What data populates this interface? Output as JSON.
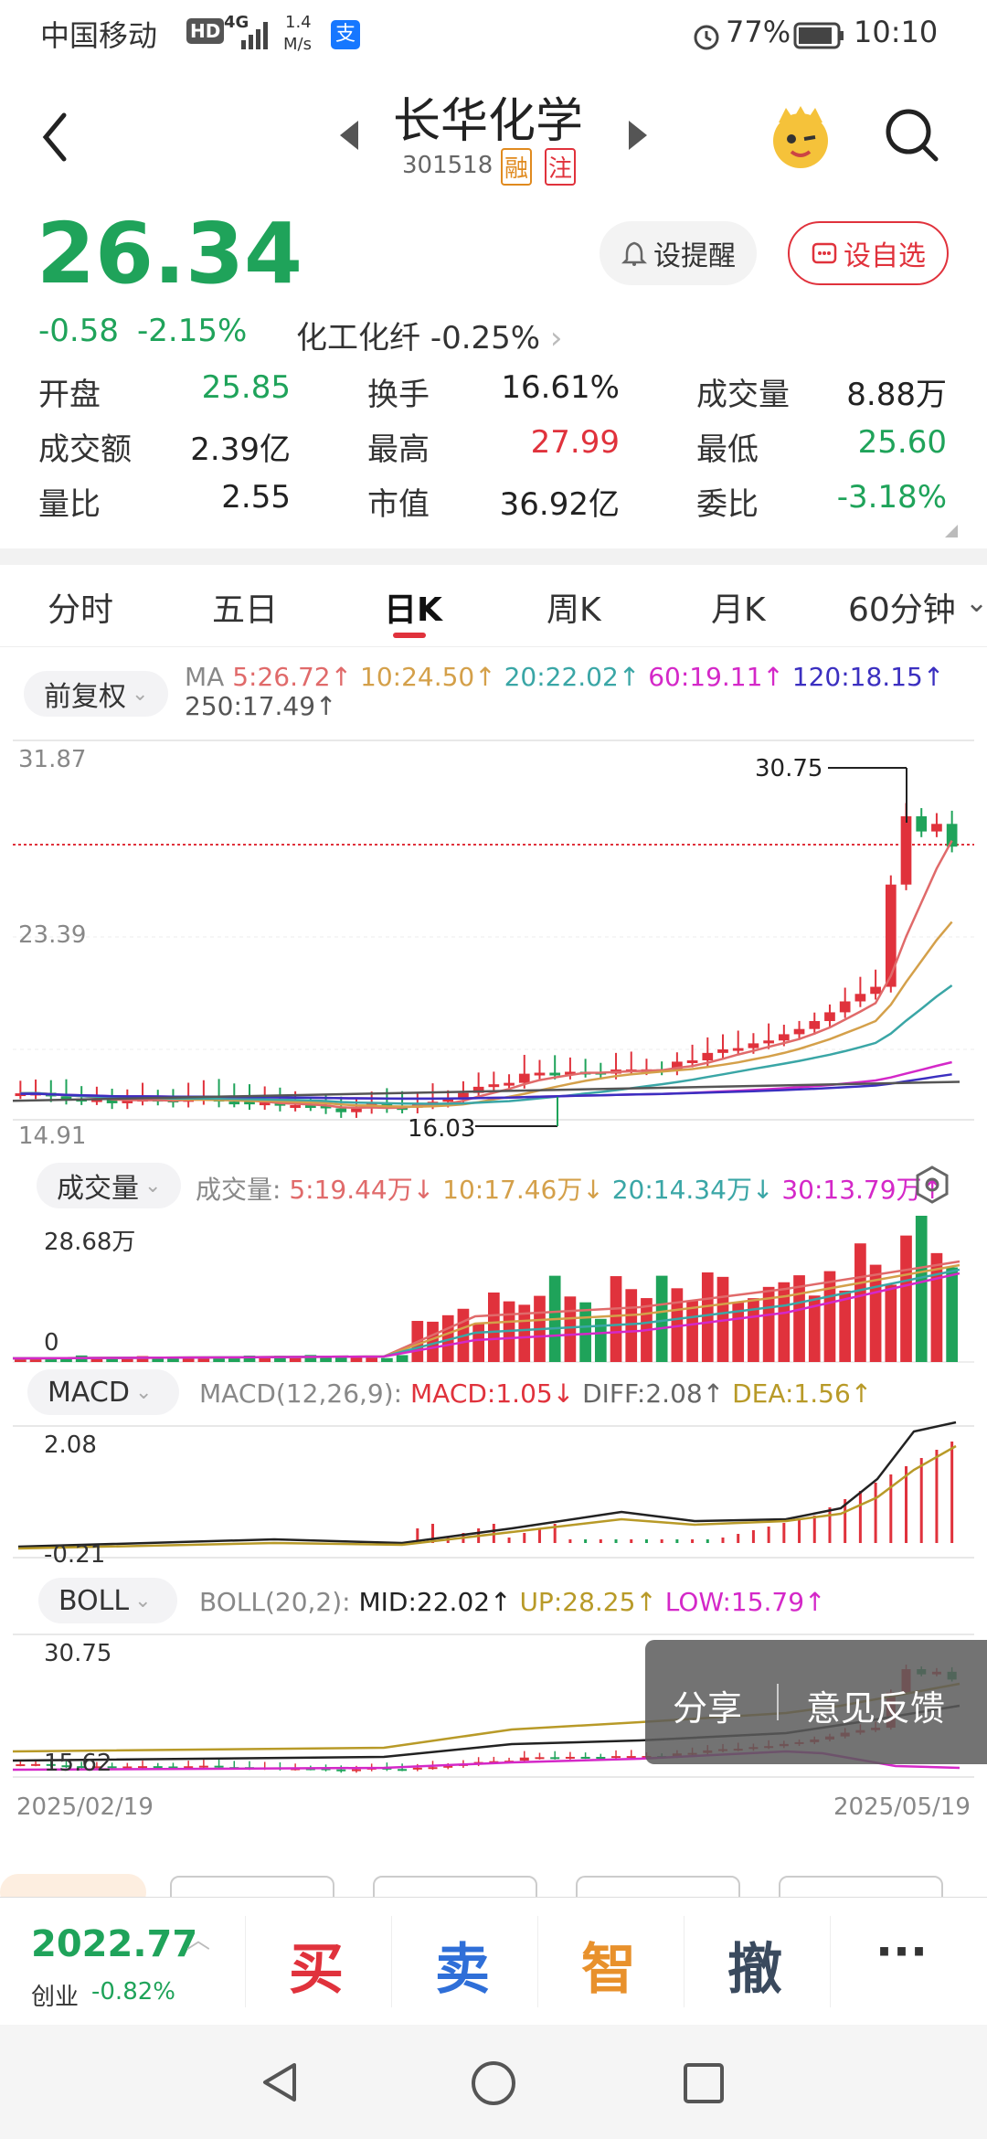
{
  "status": {
    "carrier": "中国移动",
    "hd": "HD",
    "net": "4G",
    "speed_top": "1.4",
    "speed_bottom": "M/s",
    "pay": "支",
    "battery": "77%",
    "time": "10:10"
  },
  "header": {
    "title": "长华化学",
    "code": "301518",
    "tag_margin": "融",
    "tag_note": "注"
  },
  "quote": {
    "price": "26.34",
    "change": "-0.58",
    "change_pct": "-2.15%",
    "sector": "化工化纤",
    "sector_pct": "-0.25%",
    "alert_btn": "设提醒",
    "watch_btn": "设自选"
  },
  "stats": {
    "open_l": "开盘",
    "open_v": "25.85",
    "turnover_l": "换手",
    "turnover_v": "16.61%",
    "vol_l": "成交量",
    "vol_v": "8.88万",
    "amount_l": "成交额",
    "amount_v": "2.39亿",
    "high_l": "最高",
    "high_v": "27.99",
    "low_l": "最低",
    "low_v": "25.60",
    "ratio_l": "量比",
    "ratio_v": "2.55",
    "mcap_l": "市值",
    "mcap_v": "36.92亿",
    "committee_l": "委比",
    "committee_v": "-3.18%"
  },
  "tabs": [
    "分时",
    "五日",
    "日K",
    "周K",
    "月K",
    "60分钟"
  ],
  "ma": {
    "chip": "前复权",
    "label": "MA",
    "ma5": "5:26.72↑",
    "ma10": "10:24.50↑",
    "ma20": "20:22.02↑",
    "ma60": "60:19.11↑",
    "ma120": "120:18.15↑",
    "ma250": "250:17.49↑"
  },
  "kline": {
    "ymax": "31.87",
    "ymid": "23.39",
    "ymin": "14.91",
    "hi_ann": "30.75",
    "lo_ann": "16.03"
  },
  "volume": {
    "chip": "成交量",
    "title": "成交量:",
    "v5": "5:19.44万↓",
    "v10": "10:17.46万↓",
    "v20": "20:14.34万↓",
    "v30": "30:13.79万↑",
    "ymax": "28.68万",
    "ymin": "0"
  },
  "macd": {
    "chip": "MACD",
    "params": "MACD(12,26,9):",
    "macd": "MACD:1.05↓",
    "diff": "DIFF:2.08↑",
    "dea": "DEA:1.56↑",
    "ymax": "2.08",
    "ymin": "-0.21"
  },
  "boll": {
    "chip": "BOLL",
    "params": "BOLL(20,2):",
    "mid": "MID:22.02↑",
    "up": "UP:28.25↑",
    "low": "LOW:15.79↑",
    "ymax": "30.75",
    "ymin": "15.62",
    "date_start": "2025/02/19",
    "date_end": "2025/05/19"
  },
  "overlay": {
    "share": "分享",
    "feedback": "意见反馈"
  },
  "bottom": {
    "index_val": "2022.77",
    "index_name": "创业",
    "index_pct": "-0.82%",
    "buy": "买",
    "sell": "卖",
    "smart": "智",
    "cancel": "撤",
    "more": "···"
  },
  "colors": {
    "up": "#e0323c",
    "down": "#1fa35a",
    "ma5": "#e06a6a",
    "ma10": "#d4a04a",
    "ma20": "#3aa6a6",
    "ma60": "#d428c8",
    "ma120": "#3b2fc0",
    "ma250": "#555555"
  }
}
